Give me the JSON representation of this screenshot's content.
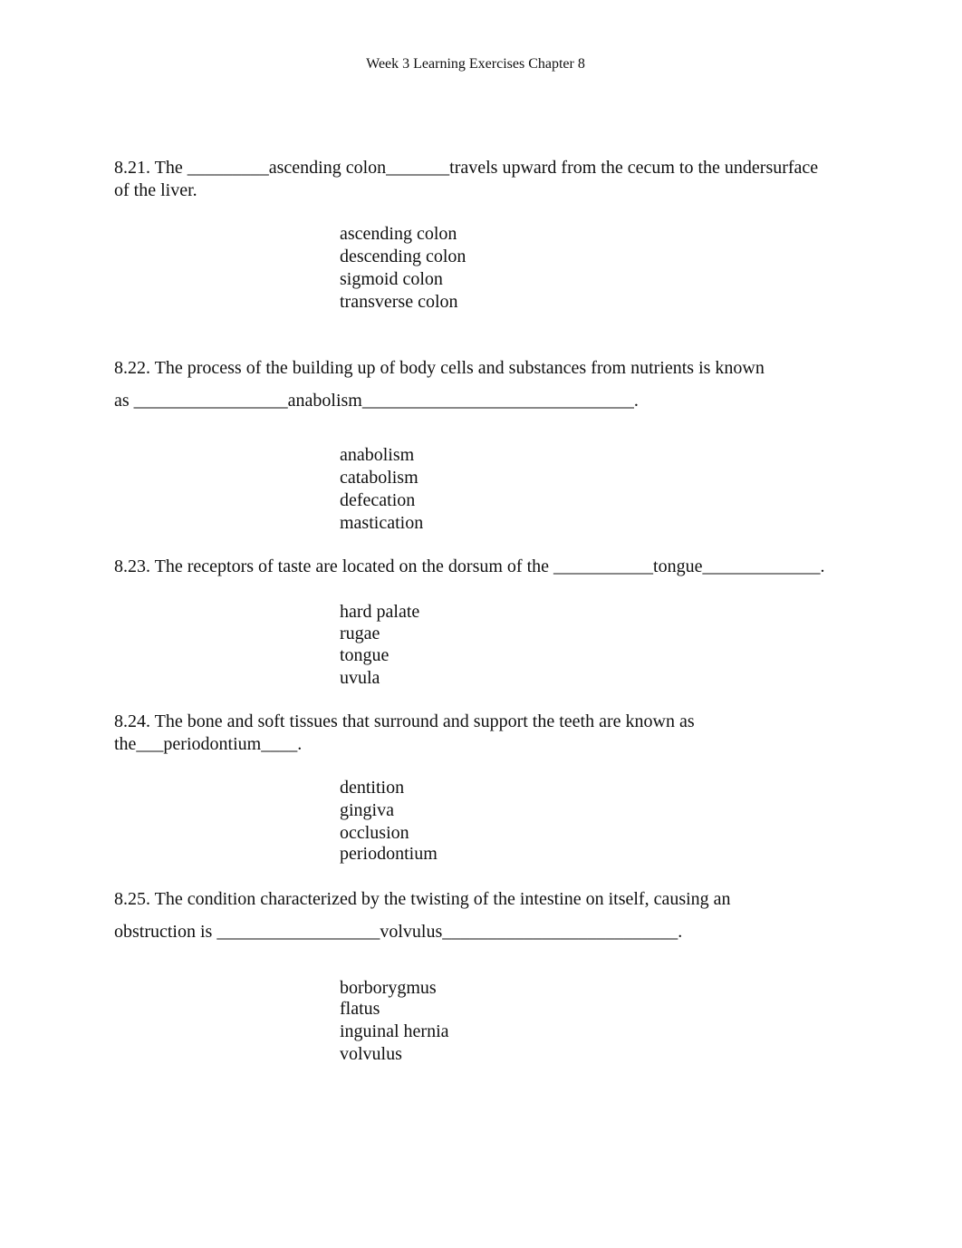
{
  "header": "Week 3 Learning Exercises Chapter 8",
  "questions": [
    {
      "number": "8.21.",
      "lines": [
        "8.21. The _________ascending colon_______travels upward from the cecum to the undersurface",
        "of the liver."
      ],
      "answer": "ascending colon",
      "options": [
        "ascending colon",
        "descending colon",
        "sigmoid colon",
        "transverse colon"
      ]
    },
    {
      "number": "8.22.",
      "lines": [
        "8.22. The process of the building up of body cells and substances from nutrients is known",
        "as _________________anabolism______________________________."
      ],
      "answer": "anabolism",
      "options": [
        "anabolism",
        "catabolism",
        "defecation",
        "mastication"
      ]
    },
    {
      "number": "8.23.",
      "lines": [
        "8.23. The receptors of taste are located on the dorsum of the ___________tongue_____________."
      ],
      "answer": "tongue",
      "options": [
        "hard palate",
        "rugae",
        "tongue",
        "uvula"
      ]
    },
    {
      "number": "8.24.",
      "lines": [
        "8.24. The bone and soft tissues that surround and support the teeth are known as",
        "the___periodontium____."
      ],
      "answer": "periodontium",
      "options": [
        "dentition",
        "gingiva",
        "occlusion",
        "periodontium"
      ]
    },
    {
      "number": "8.25.",
      "lines": [
        "8.25. The condition characterized by the twisting of the intestine on itself, causing an",
        "obstruction is __________________volvulus__________________________."
      ],
      "answer": "volvulus",
      "options": [
        "borborygmus",
        "flatus",
        "inguinal hernia",
        "volvulus"
      ]
    }
  ]
}
